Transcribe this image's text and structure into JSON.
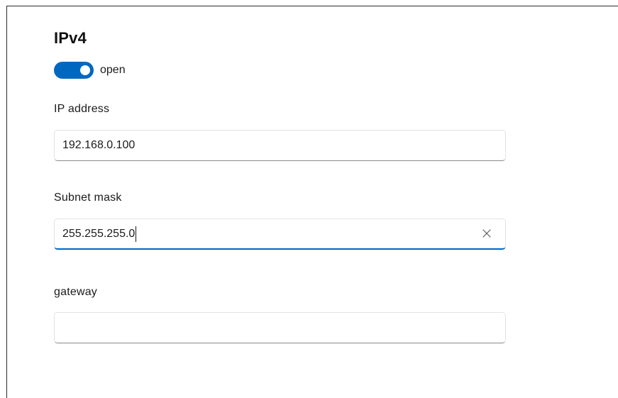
{
  "section": {
    "title": "IPv4"
  },
  "toggle": {
    "label": "open",
    "state": "on",
    "accent_color": "#0067c0"
  },
  "fields": {
    "ip_address": {
      "label": "IP address",
      "value": "192.168.0.100"
    },
    "subnet_mask": {
      "label": "Subnet mask",
      "value": "255.255.255.0",
      "focused": true,
      "clear_icon": "close-icon"
    },
    "gateway": {
      "label": "gateway",
      "value": ""
    }
  }
}
